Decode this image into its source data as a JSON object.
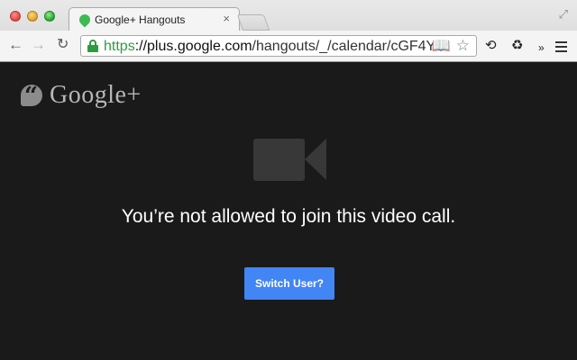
{
  "browser": {
    "tab": {
      "title": "Google+ Hangouts",
      "close": "×"
    },
    "toolbar": {
      "back": "←",
      "forward": "→",
      "reload": "↻",
      "url_scheme": "https",
      "url_host": "://plus.google.com",
      "url_path": "/hangouts/_/calendar/cGF4Y…",
      "reader_icon": "📖",
      "star_icon": "☆",
      "ext_refresh": "⟲",
      "ext_recycle": "♻",
      "overflow": "»"
    },
    "fullscreen": "⤢"
  },
  "page": {
    "brand": "Google+",
    "message": "You’re not allowed to join this video call.",
    "switch_user_label": "Switch User?"
  },
  "colors": {
    "background": "#1a1a1a",
    "button": "#4285f4",
    "secure": "#2c9d3c",
    "camera": "#383838"
  }
}
